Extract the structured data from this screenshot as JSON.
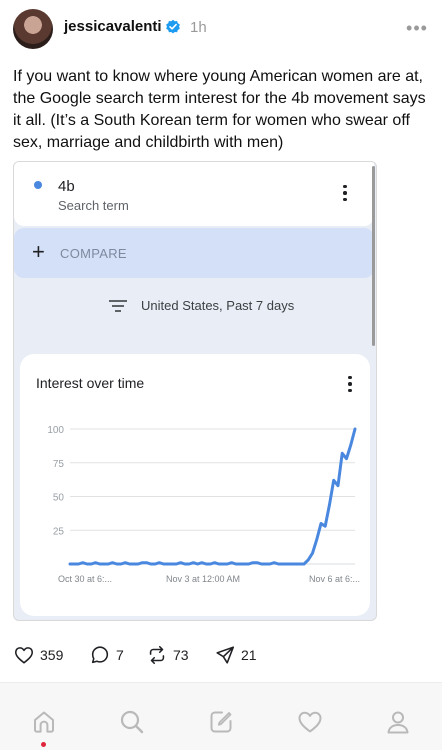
{
  "post": {
    "username": "jessicavalenti",
    "timestamp": "1h",
    "text": "If you want to know where young American women are at, the Google search term interest for the 4b movement says it all. (It’s a South Korean term for women who swear off sex, marriage and childbirth with men)"
  },
  "embed": {
    "term": {
      "name": "4b",
      "subtitle": "Search term"
    },
    "compare_label": "COMPARE",
    "filter_text": "United States, Past 7 days",
    "chart_title": "Interest over time"
  },
  "chart_data": {
    "type": "line",
    "title": "Interest over time",
    "ylim": [
      0,
      100
    ],
    "y_ticks": [
      25,
      50,
      75,
      100
    ],
    "x_tick_labels": [
      "Oct 30 at 6:...",
      "Nov 3 at 12:00 AM",
      "Nov 6 at 6:..."
    ],
    "series": [
      {
        "color": "#4a88e0",
        "values": [
          0,
          0,
          0,
          1,
          0,
          0,
          1,
          0,
          0,
          0,
          1,
          0,
          0,
          1,
          0,
          0,
          0,
          1,
          1,
          0,
          0,
          1,
          0,
          0,
          0,
          0,
          1,
          0,
          0,
          1,
          0,
          1,
          0,
          0,
          1,
          0,
          0,
          0,
          1,
          0,
          0,
          0,
          0,
          1,
          1,
          0,
          0,
          0,
          1,
          0,
          0,
          0,
          0,
          0,
          0,
          0,
          3,
          8,
          18,
          30,
          28,
          44,
          62,
          58,
          82,
          78,
          88,
          100
        ]
      }
    ]
  },
  "actions": {
    "likes": "359",
    "replies": "7",
    "reposts": "73",
    "shares": "21"
  },
  "colors": {
    "line": "#4a88e0",
    "accent_dot": "#e0243c",
    "verified": "#1d9bf0"
  }
}
